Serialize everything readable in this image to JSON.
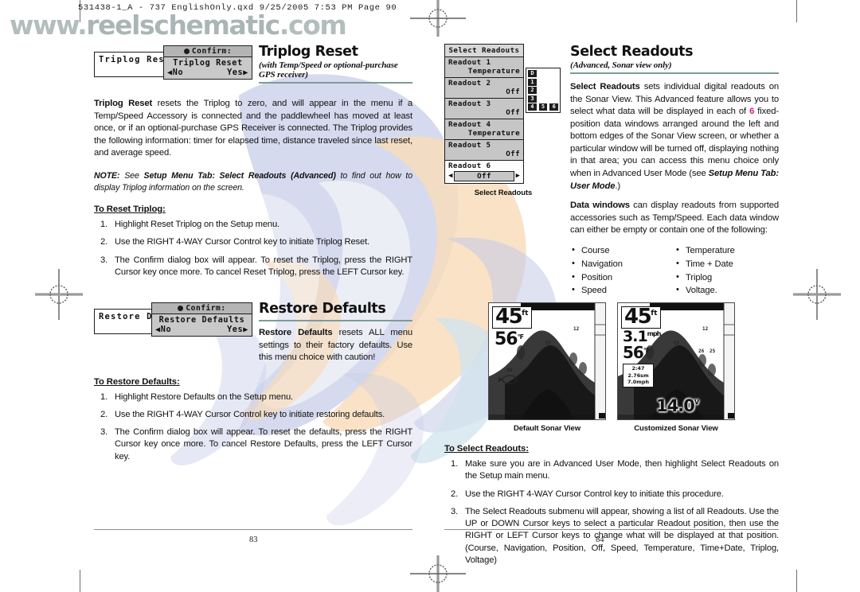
{
  "slug": "531438-1_A - 737 EnglishOnly.qxd   9/25/2005   7:53 PM   Page 90",
  "watermark": {
    "part1": "www.",
    "part2": "reelschematic",
    "part3": ".com"
  },
  "left_page": {
    "page_number": "83",
    "triplog": {
      "dialog": {
        "back_label": "Triplog Rese",
        "header": "Confirm:",
        "title": "Triplog Reset",
        "no": "No",
        "yes": "Yes",
        "left_arrow": "◀",
        "right_arrow": "▶"
      },
      "heading": "Triplog Reset",
      "subheading": "(with Temp/Speed or optional-purchase GPS receiver)",
      "body_lead": "Triplog Reset",
      "body_rest": " resets the Triplog to zero, and will appear in the menu if a Temp/Speed Accessory is connected and the paddlewheel has moved at least once, or if an optional-purchase GPS Receiver is connected. The Triplog provides the following information: timer for elapsed time, distance traveled since last reset, and average speed.",
      "note_label": "NOTE:",
      "note_text_1": "  See ",
      "note_bold": "Setup Menu Tab: Select Readouts (Advanced)",
      "note_text_2": " to find out how to display Triplog information on the screen.",
      "steps_title": "To Reset Triplog:",
      "steps": [
        "Highlight Reset Triplog on the Setup menu.",
        "Use the RIGHT 4-WAY Cursor Control key to initiate Triplog Reset.",
        "The Confirm dialog box will appear. To reset the Triplog, press the RIGHT Cursor key once more. To cancel Reset Triplog, press the LEFT Cursor key."
      ]
    },
    "restore": {
      "dialog": {
        "back_label": "Restore De",
        "header": "Confirm:",
        "title": "Restore Defaults",
        "no": "No",
        "yes": "Yes",
        "left_arrow": "◀",
        "right_arrow": "▶"
      },
      "heading": "Restore Defaults",
      "body_lead": "Restore Defaults",
      "body_rest": " resets ALL menu settings to their factory defaults. Use this menu choice with caution!",
      "steps_title": "To Restore Defaults:",
      "steps": [
        "Highlight Restore Defaults on the Setup menu.",
        "Use the RIGHT 4-WAY Cursor Control key to initiate restoring defaults.",
        "The Confirm dialog box will appear. To reset the defaults,  press the RIGHT Cursor key once more. To cancel Restore Defaults, press the LEFT Cursor key."
      ]
    }
  },
  "right_page": {
    "page_number": "84",
    "menu": {
      "title": "Select Readouts",
      "caption": "Select Readouts",
      "items": [
        {
          "label": "Readout 1",
          "value": "Temperature",
          "selected": false
        },
        {
          "label": "Readout 2",
          "value": "Off",
          "selected": false
        },
        {
          "label": "Readout 3",
          "value": "Off",
          "selected": false
        },
        {
          "label": "Readout 4",
          "value": "Temperature",
          "selected": false
        },
        {
          "label": "Readout 5",
          "value": "Off",
          "selected": false
        },
        {
          "label": "Readout 6",
          "value": "Off",
          "selected": true
        }
      ],
      "slider_left_arrow": "◀",
      "slider_right_arrow": "▶"
    },
    "position_key": {
      "left_column": [
        "D",
        "1",
        "2",
        "3",
        "4"
      ],
      "bottom_row": [
        "5",
        "6"
      ]
    },
    "heading": "Select Readouts",
    "subheading": "(Advanced, Sonar view only)",
    "para1_lead": "Select Readouts",
    "para1_a": " sets individual digital readouts on the Sonar View. This Advanced feature allows you to select what data will be displayed in each of ",
    "para1_highlight": "6",
    "para1_b": " fixed-position data windows arranged around the left and bottom edges of the Sonar View screen, or whether a particular window will be turned off, displaying nothing in that area; you can access this menu choice only when in Advanced User Mode (see ",
    "para1_bold": "Setup Menu Tab: User Mode",
    "para1_c": ".)",
    "highlight_color": "#e3128b",
    "para2_lead": "Data windows",
    "para2_rest": " can display readouts from supported accessories such as Temp/Speed. Each data window can either be empty or contain one of the following:",
    "bullets_left": [
      "Course",
      "Navigation",
      "Position",
      "Speed"
    ],
    "bullets_right": [
      "Temperature",
      "Time + Date",
      "Triplog",
      "Voltage."
    ],
    "sonar_default": {
      "caption": "Default Sonar View",
      "depth": "45",
      "depth_unit": "ft",
      "temp": "56",
      "temp_unit": "°F"
    },
    "sonar_custom": {
      "caption": "Customized Sonar View",
      "depth": "45",
      "depth_unit": "ft",
      "speed": "3.1",
      "speed_unit": "mph",
      "temp": "56",
      "temp_unit": "°F",
      "triplog_time": "2:47",
      "triplog_dist": "2.76sm",
      "triplog_speed": "7.0mph",
      "voltage": "14.0",
      "voltage_unit": "V"
    },
    "steps_title": "To Select Readouts:",
    "steps": [
      "Make sure you are in Advanced User Mode, then highlight Select Readouts on the Setup main menu.",
      "Use the RIGHT 4-WAY Cursor Control key to initiate this procedure.",
      "The Select Readouts submenu will appear, showing a list of all Readouts. Use the UP or DOWN Cursor keys to select a particular Readout position, then use the RIGHT or LEFT Cursor keys to change what will be displayed at that position. (Course, Navigation, Position, Off, Speed, Temperature, Time+Date, Triplog, Voltage)"
    ]
  }
}
